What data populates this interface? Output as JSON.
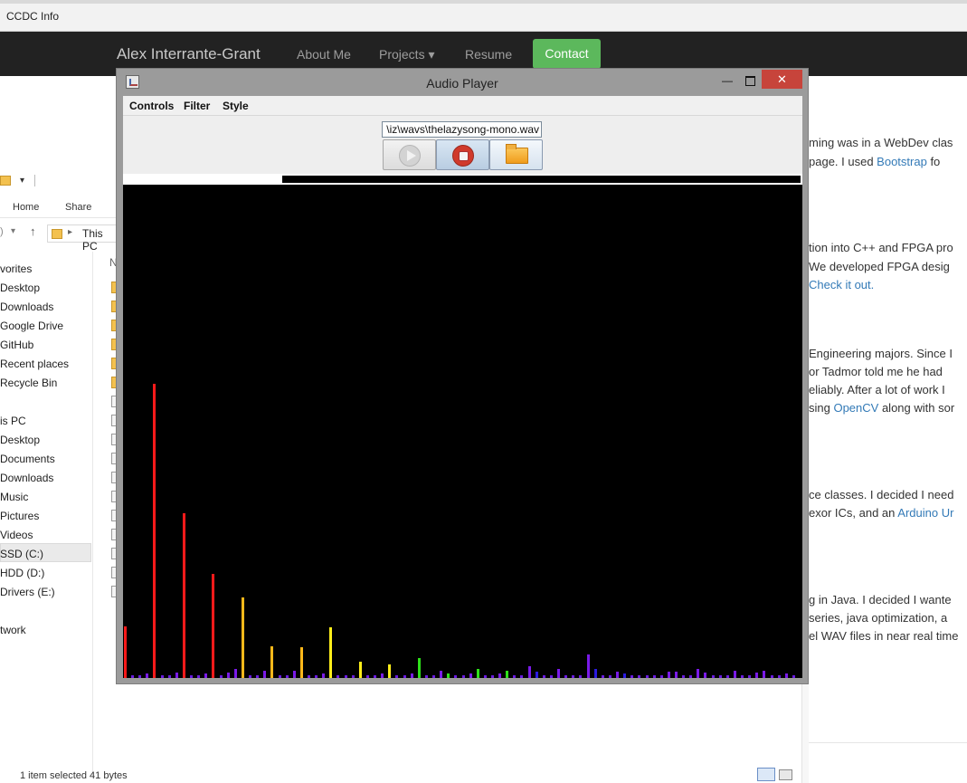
{
  "browser": {
    "title": "CCDC Info"
  },
  "site": {
    "brand": "Alex Interrante-Grant",
    "nav": [
      {
        "label": "About Me"
      },
      {
        "label": "Projects ▾"
      },
      {
        "label": "Resume"
      }
    ],
    "contact_label": "Contact",
    "paragraph_lines": [
      {
        "text": "ming was in a WebDev clas",
        "link": ""
      },
      {
        "text": "page. I used ",
        "link": "Bootstrap",
        "after": " fo"
      },
      {
        "text": "tion into C++ and FPGA pro",
        "link": ""
      },
      {
        "text": "We developed FPGA desig",
        "link": ""
      },
      {
        "text": "",
        "link": "Check it out."
      },
      {
        "text": "Engineering majors. Since I",
        "link": ""
      },
      {
        "text": "or Tadmor told me he had",
        "link": ""
      },
      {
        "text": "eliably. After a lot of work I",
        "link": ""
      },
      {
        "text": "sing ",
        "link": "OpenCV",
        "after": " along with sor"
      },
      {
        "text": "ce classes. I decided I need",
        "link": ""
      },
      {
        "text": "exor ICs, and an ",
        "link": "Arduino Ur"
      },
      {
        "text": "g in Java. I decided I wante",
        "link": ""
      },
      {
        "text": "series, java optimization, a",
        "link": ""
      },
      {
        "text": "el WAV files in near real time",
        "link": ""
      }
    ]
  },
  "explorer": {
    "ribbon": [
      "Home",
      "Share"
    ],
    "address": "This PC",
    "column_header": "N",
    "tree": [
      "vorites",
      "Desktop",
      "Downloads",
      "Google Drive",
      "GitHub",
      "Recent places",
      "Recycle Bin",
      "is PC",
      "Desktop",
      "Documents",
      "Downloads",
      "Music",
      "Pictures",
      "Videos",
      "SSD (C:)",
      "HDD (D:)",
      "Drivers (E:)",
      "twork"
    ],
    "status": "1 item selected  41 bytes"
  },
  "audio_player": {
    "title": "Audio Player",
    "minimize_glyph": "—",
    "close_glyph": "✕",
    "menus": [
      "Controls",
      "Filter",
      "Style"
    ],
    "file_path": "\\iz\\wavs\\thelazysong-mono.wav",
    "buttons": {
      "play": "play-icon",
      "stop": "stop-icon",
      "open": "folder-icon"
    },
    "progress": 0.233,
    "spectrum": [
      {
        "h": 57,
        "c": "#ff1a1a"
      },
      {
        "h": 3,
        "c": "#6a1ae0"
      },
      {
        "h": 3,
        "c": "#6a1ae0"
      },
      {
        "h": 5,
        "c": "#7a1ae8"
      },
      {
        "h": 325,
        "c": "#ff1a1a"
      },
      {
        "h": 3,
        "c": "#6a1ae0"
      },
      {
        "h": 3,
        "c": "#6a1ae0"
      },
      {
        "h": 6,
        "c": "#7a1ae8"
      },
      {
        "h": 182,
        "c": "#ff1a1a"
      },
      {
        "h": 3,
        "c": "#6a1ae0"
      },
      {
        "h": 3,
        "c": "#6a1ae0"
      },
      {
        "h": 5,
        "c": "#7a1ae8"
      },
      {
        "h": 115,
        "c": "#ff1a1a"
      },
      {
        "h": 3,
        "c": "#6a1ae0"
      },
      {
        "h": 6,
        "c": "#7a1ae8"
      },
      {
        "h": 10,
        "c": "#7a1ae8"
      },
      {
        "h": 89,
        "c": "#ffb81a"
      },
      {
        "h": 3,
        "c": "#6a1ae0"
      },
      {
        "h": 3,
        "c": "#6a1ae0"
      },
      {
        "h": 8,
        "c": "#7a1ae8"
      },
      {
        "h": 35,
        "c": "#ffb81a"
      },
      {
        "h": 3,
        "c": "#6a1ae0"
      },
      {
        "h": 3,
        "c": "#6a1ae0"
      },
      {
        "h": 8,
        "c": "#7a1ae8"
      },
      {
        "h": 34,
        "c": "#ffb81a"
      },
      {
        "h": 3,
        "c": "#6a1ae0"
      },
      {
        "h": 3,
        "c": "#6a1ae0"
      },
      {
        "h": 5,
        "c": "#7a1ae8"
      },
      {
        "h": 56,
        "c": "#ffee1a"
      },
      {
        "h": 3,
        "c": "#6a1ae0"
      },
      {
        "h": 3,
        "c": "#6a1ae0"
      },
      {
        "h": 3,
        "c": "#6a1ae0"
      },
      {
        "h": 18,
        "c": "#ffee1a"
      },
      {
        "h": 3,
        "c": "#6a1ae0"
      },
      {
        "h": 3,
        "c": "#6a1ae0"
      },
      {
        "h": 5,
        "c": "#7a1ae8"
      },
      {
        "h": 15,
        "c": "#ffee1a"
      },
      {
        "h": 3,
        "c": "#6a1ae0"
      },
      {
        "h": 3,
        "c": "#6a1ae0"
      },
      {
        "h": 5,
        "c": "#7a1ae8"
      },
      {
        "h": 22,
        "c": "#2ee01a"
      },
      {
        "h": 3,
        "c": "#6a1ae0"
      },
      {
        "h": 3,
        "c": "#6a1ae0"
      },
      {
        "h": 8,
        "c": "#7a1ae8"
      },
      {
        "h": 5,
        "c": "#2ee01a"
      },
      {
        "h": 3,
        "c": "#6a1ae0"
      },
      {
        "h": 3,
        "c": "#6a1ae0"
      },
      {
        "h": 5,
        "c": "#7a1ae8"
      },
      {
        "h": 10,
        "c": "#2ee01a"
      },
      {
        "h": 3,
        "c": "#6a1ae0"
      },
      {
        "h": 3,
        "c": "#6a1ae0"
      },
      {
        "h": 5,
        "c": "#7a1ae8"
      },
      {
        "h": 8,
        "c": "#2ee01a"
      },
      {
        "h": 3,
        "c": "#6a1ae0"
      },
      {
        "h": 3,
        "c": "#6a1ae0"
      },
      {
        "h": 13,
        "c": "#7a1ae8"
      },
      {
        "h": 7,
        "c": "#2a1ae0"
      },
      {
        "h": 3,
        "c": "#6a1ae0"
      },
      {
        "h": 3,
        "c": "#6a1ae0"
      },
      {
        "h": 10,
        "c": "#7a1ae8"
      },
      {
        "h": 3,
        "c": "#6a1ae0"
      },
      {
        "h": 3,
        "c": "#6a1ae0"
      },
      {
        "h": 3,
        "c": "#6a1ae0"
      },
      {
        "h": 26,
        "c": "#7a1ae8"
      },
      {
        "h": 10,
        "c": "#2a1ae0"
      },
      {
        "h": 3,
        "c": "#6a1ae0"
      },
      {
        "h": 3,
        "c": "#6a1ae0"
      },
      {
        "h": 7,
        "c": "#7a1ae8"
      },
      {
        "h": 5,
        "c": "#2a1ae0"
      },
      {
        "h": 3,
        "c": "#6a1ae0"
      },
      {
        "h": 3,
        "c": "#6a1ae0"
      },
      {
        "h": 3,
        "c": "#6a1ae0"
      },
      {
        "h": 3,
        "c": "#6a1ae0"
      },
      {
        "h": 3,
        "c": "#6a1ae0"
      },
      {
        "h": 7,
        "c": "#7a1ae8"
      },
      {
        "h": 7,
        "c": "#7a1ae8"
      },
      {
        "h": 3,
        "c": "#6a1ae0"
      },
      {
        "h": 3,
        "c": "#6a1ae0"
      },
      {
        "h": 10,
        "c": "#7a1ae8"
      },
      {
        "h": 6,
        "c": "#7a1ae8"
      },
      {
        "h": 3,
        "c": "#6a1ae0"
      },
      {
        "h": 3,
        "c": "#6a1ae0"
      },
      {
        "h": 3,
        "c": "#6a1ae0"
      },
      {
        "h": 8,
        "c": "#7a1ae8"
      },
      {
        "h": 3,
        "c": "#6a1ae0"
      },
      {
        "h": 3,
        "c": "#6a1ae0"
      },
      {
        "h": 6,
        "c": "#7a1ae8"
      },
      {
        "h": 8,
        "c": "#7a1ae8"
      },
      {
        "h": 3,
        "c": "#6a1ae0"
      },
      {
        "h": 3,
        "c": "#6a1ae0"
      },
      {
        "h": 5,
        "c": "#7a1ae8"
      },
      {
        "h": 3,
        "c": "#6a1ae0"
      }
    ]
  }
}
